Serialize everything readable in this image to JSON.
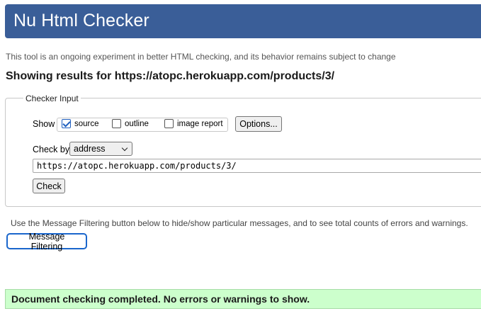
{
  "header": {
    "title": "Nu Html Checker"
  },
  "intro_text": "This tool is an ongoing experiment in better HTML checking, and its behavior remains subject to change",
  "results_title": "Showing results for https://atopc.herokuapp.com/products/3/",
  "checker_input": {
    "legend": "Checker Input",
    "show_label": "Show",
    "checkboxes": [
      {
        "label": "source",
        "checked": true
      },
      {
        "label": "outline",
        "checked": false
      },
      {
        "label": "image report",
        "checked": false
      }
    ],
    "options_button": "Options...",
    "check_by_label": "Check by",
    "check_by_value": "address",
    "url_value": "https://atopc.herokuapp.com/products/3/",
    "check_button": "Check"
  },
  "filter_note": "Use the Message Filtering button below to hide/show particular messages, and to see total counts of errors and warnings.",
  "message_filtering_button": "Message Filtering",
  "status_message": "Document checking completed. No errors or warnings to show.",
  "colors": {
    "header_bg": "#3a5e98",
    "success_bg": "#ccffcc",
    "focus_ring": "#1a66cc"
  }
}
